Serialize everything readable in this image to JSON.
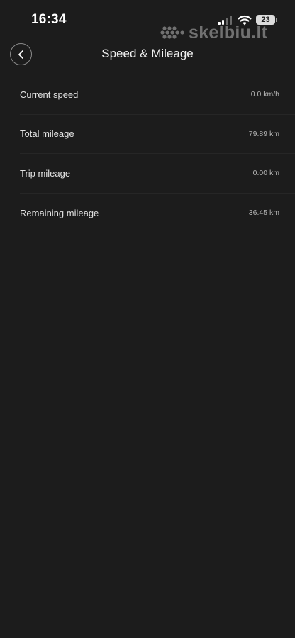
{
  "status_bar": {
    "time": "16:34",
    "battery": "23",
    "signal_icon": "cellular-signal-icon",
    "wifi_icon": "wifi-icon",
    "battery_icon": "battery-icon"
  },
  "watermark": {
    "text": "skelbiu.lt"
  },
  "header": {
    "title": "Speed & Mileage",
    "back_icon": "chevron-left-icon"
  },
  "items": [
    {
      "label": "Current speed",
      "value": "0.0 km/h"
    },
    {
      "label": "Total mileage",
      "value": "79.89 km"
    },
    {
      "label": "Trip mileage",
      "value": "0.00 km"
    },
    {
      "label": "Remaining mileage",
      "value": "36.45 km"
    }
  ],
  "colors": {
    "background": "#1c1c1c",
    "text_primary": "#e2e2e2",
    "text_secondary": "#b4b4b4"
  }
}
